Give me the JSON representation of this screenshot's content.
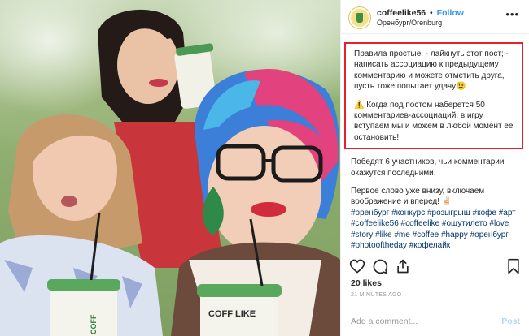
{
  "post": {
    "photo_alt": "photo",
    "photo_cup_text_left": "COFF",
    "photo_cup_text_mid": "COFF LIKE",
    "photo_cup_text_right": "COFF LIKE"
  },
  "header": {
    "username": "coffeelike56",
    "dot": "•",
    "follow_label": "Follow",
    "location": "Оренбург/Orenburg",
    "more_icon": "more-icon"
  },
  "caption": {
    "highlight_part1": "Правила простые: - лайкнуть этот пост; - написать ассоциацию к предыдущему комментарию и можете отметить друга, пусть тоже попытает удачу😉",
    "highlight_part2": "⚠️ Когда под постом наберется 50 комментариев-ассоциаций, в игру вступаем мы и можем в любой момент её остановить!",
    "block1": "Победят 6 участников, чьи комментарии окажутся последними.",
    "block2": "Первое слово уже внизу, включаем воображение и вперед! ✌🏻",
    "hashtags": "#оренбург #конкурс #розыгрыш #кофе #арт #coffeelike56 #coffeelike #ощутилето #love #story #like #me #coffee #happy #оренбург #photooftheday #кофелайк"
  },
  "actions": {
    "icons": [
      "heart-icon",
      "comment-icon",
      "share-icon",
      "bookmark-icon"
    ]
  },
  "likes_text": "20 likes",
  "timestamp": "21 MINUTES AGO",
  "comment": {
    "placeholder": "Add a comment...",
    "post_label": "Post"
  },
  "colors": {
    "follow": "#3897f0",
    "highlight_border": "#e8202a",
    "post_disabled": "#b3d7fb",
    "hashtag": "#003569"
  }
}
